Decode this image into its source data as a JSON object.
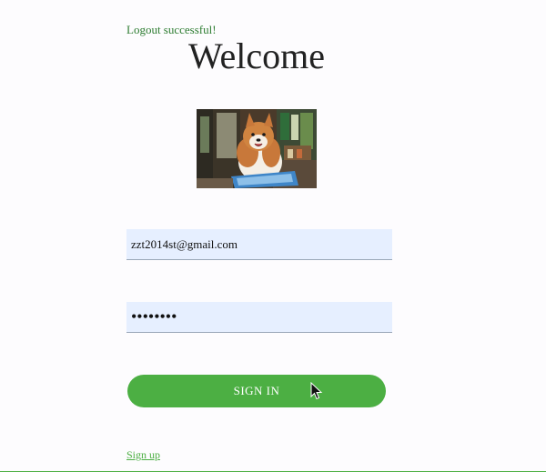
{
  "status_message": "Logout successful!",
  "title": "Welcome",
  "photo": {
    "icon": "shiba-dog-photo"
  },
  "form": {
    "email_value": "zzt2014st@gmail.com",
    "password_value": "••••••••",
    "signin_label": "SIGN IN"
  },
  "signup_link": "Sign up",
  "colors": {
    "accent": "#4caf43",
    "status": "#2e7d32",
    "field_bg": "#e6efff"
  }
}
